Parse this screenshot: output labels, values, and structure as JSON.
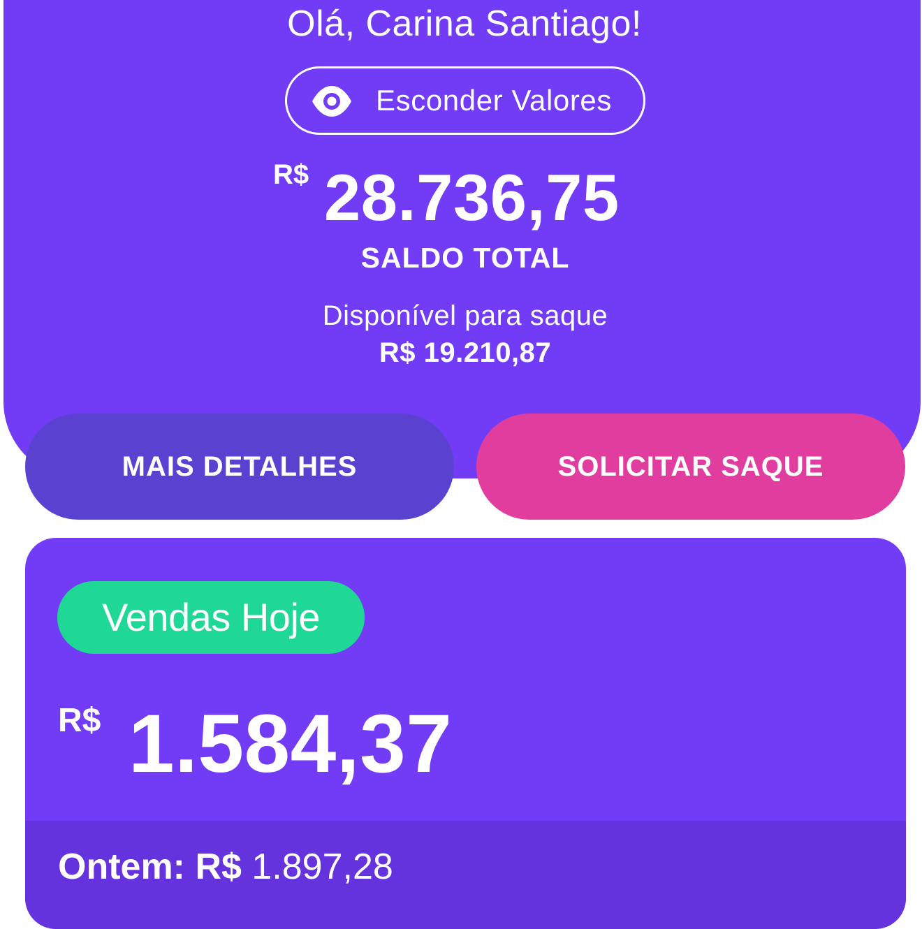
{
  "colors": {
    "primary": "#723cf6",
    "details_button": "#5b41d0",
    "withdraw_button": "#e13d9f",
    "sales_badge": "#1fd896",
    "yesterday_bar": "#6433dd",
    "text": "#ffffff"
  },
  "header": {
    "greeting": "Olá, Carina Santiago!",
    "hide_values": {
      "icon": "eye-icon",
      "label": "Esconder Valores"
    },
    "balance": {
      "currency": "R$",
      "value": "28.736,75",
      "label": "SALDO TOTAL"
    },
    "available": {
      "label": "Disponível para saque",
      "value": "R$ 19.210,87"
    }
  },
  "actions": {
    "details_label": "MAIS DETALHES",
    "withdraw_label": "SOLICITAR SAQUE"
  },
  "sales": {
    "badge": "Vendas Hoje",
    "currency": "R$",
    "value": "1.584,37",
    "yesterday_prefix": "Ontem: R$",
    "yesterday_value": " 1.897,28"
  }
}
